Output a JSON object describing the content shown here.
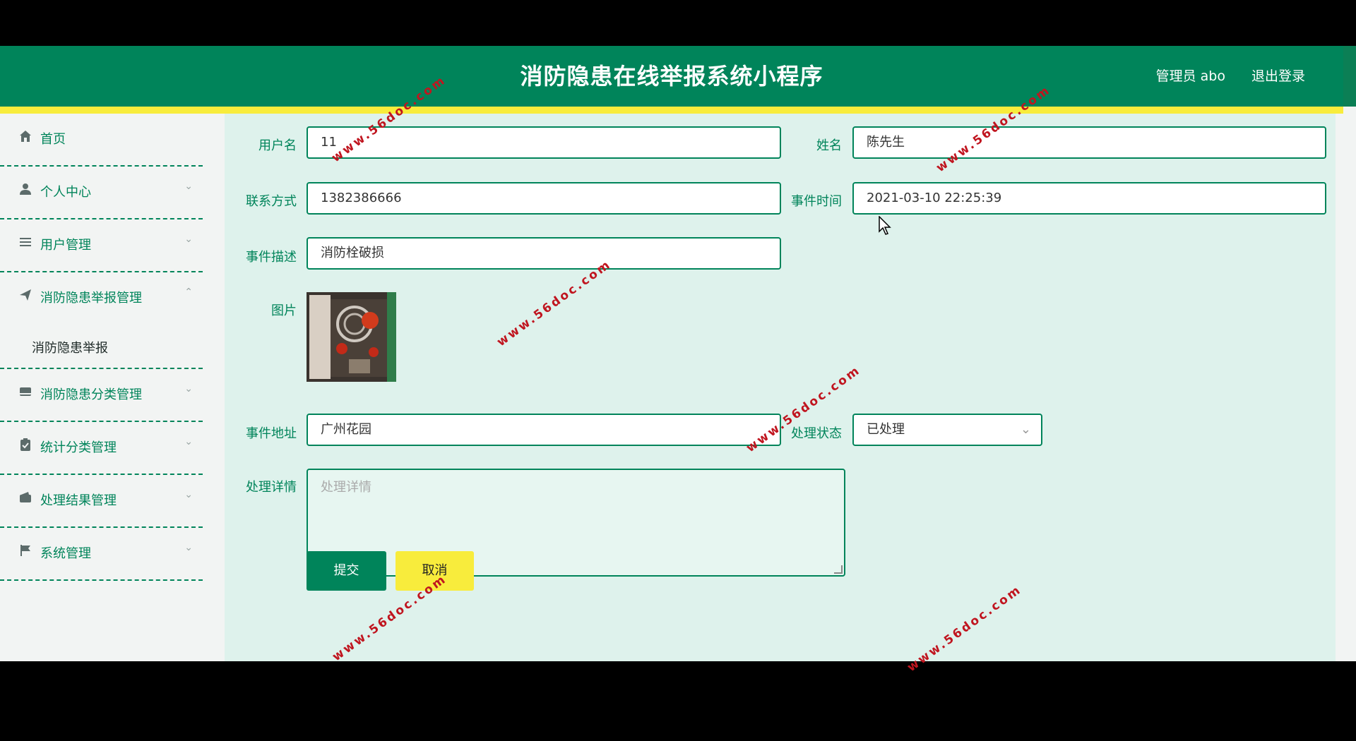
{
  "header": {
    "title": "消防隐患在线举报系统小程序",
    "admin_label": "管理员 abo",
    "logout_label": "退出登录"
  },
  "sidebar": {
    "items": [
      {
        "label": "首页",
        "icon": "home-icon",
        "expanded": false,
        "chevron": ""
      },
      {
        "label": "个人中心",
        "icon": "user-icon",
        "expanded": false,
        "chevron": "⌄"
      },
      {
        "label": "用户管理",
        "icon": "list-icon",
        "expanded": false,
        "chevron": "⌄"
      },
      {
        "label": "消防隐患举报管理",
        "icon": "send-icon",
        "expanded": true,
        "chevron": "⌃"
      },
      {
        "label": "消防隐患分类管理",
        "icon": "box-icon",
        "expanded": false,
        "chevron": "⌄"
      },
      {
        "label": "统计分类管理",
        "icon": "clipboard-icon",
        "expanded": false,
        "chevron": "⌄"
      },
      {
        "label": "处理结果管理",
        "icon": "wallet-icon",
        "expanded": false,
        "chevron": "⌄"
      },
      {
        "label": "系统管理",
        "icon": "flag-icon",
        "expanded": false,
        "chevron": "⌄"
      }
    ],
    "submenu_label": "消防隐患举报"
  },
  "form": {
    "username": {
      "label": "用户名",
      "value": "11"
    },
    "name": {
      "label": "姓名",
      "value": "陈先生"
    },
    "phone": {
      "label": "联系方式",
      "value": "1382386666"
    },
    "event_time": {
      "label": "事件时间",
      "value": "2021-03-10 22:25:39"
    },
    "description": {
      "label": "事件描述",
      "value": "消防栓破损"
    },
    "image": {
      "label": "图片"
    },
    "address": {
      "label": "事件地址",
      "value": "广州花园"
    },
    "status": {
      "label": "处理状态",
      "value": "已处理"
    },
    "details": {
      "label": "处理详情",
      "placeholder": "处理详情"
    },
    "submit_label": "提交",
    "cancel_label": "取消"
  },
  "watermark_text": "www.56doc.com",
  "colors": {
    "primary_green": "#00845a",
    "accent_yellow": "#f8ec3c",
    "content_bg": "#def2ec",
    "watermark": "#c0151f"
  }
}
